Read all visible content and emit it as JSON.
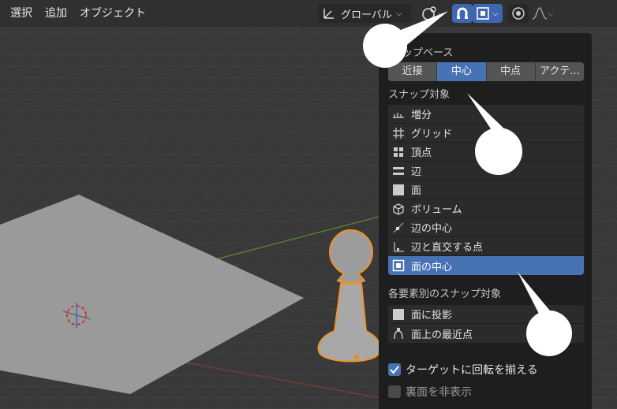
{
  "header": {
    "menus": [
      "選択",
      "追加",
      "オブジェクト"
    ],
    "orientation": {
      "label": "グローバル",
      "icon": "transform-orientation-icon"
    },
    "pivot_icon": "pivot-icon",
    "snap_icon": "magnet-icon",
    "snap_target_icon": "snap-face-center-icon",
    "proportional_icon": "proportional-edit-icon",
    "falloff_icon": "falloff-curve-icon"
  },
  "popup": {
    "snap_base_label": "ップベース",
    "snap_base_options": [
      "近接",
      "中心",
      "中点",
      "アクテ..."
    ],
    "snap_base_selected": "中心",
    "snap_target_label": "スナップ対象",
    "snap_targets": [
      {
        "label": "増分",
        "icon": "increment-icon"
      },
      {
        "label": "グリッド",
        "icon": "grid-icon"
      },
      {
        "label": "頂点",
        "icon": "vertex-icon"
      },
      {
        "label": "辺",
        "icon": "edge-icon"
      },
      {
        "label": "面",
        "icon": "face-icon"
      },
      {
        "label": "ボリューム",
        "icon": "volume-icon"
      },
      {
        "label": "辺の中心",
        "icon": "edge-center-icon"
      },
      {
        "label": "辺と直交する点",
        "icon": "edge-perpendicular-icon"
      },
      {
        "label": "面の中心",
        "icon": "face-center-icon",
        "selected": true
      }
    ],
    "per_element_label": "各要素別のスナップ対象",
    "per_element_targets": [
      {
        "label": "面に投影",
        "icon": "face-project-icon"
      },
      {
        "label": "面上の最近点",
        "icon": "face-nearest-icon"
      }
    ],
    "align_rotation": {
      "label": "ターゲットに回転を揃える",
      "checked": true
    },
    "backface": {
      "label": "裏面を非表示",
      "checked": false
    }
  },
  "colors": {
    "accent": "#4772b3",
    "object_outline": "#f0922a",
    "viewport_bg": "#393939"
  }
}
